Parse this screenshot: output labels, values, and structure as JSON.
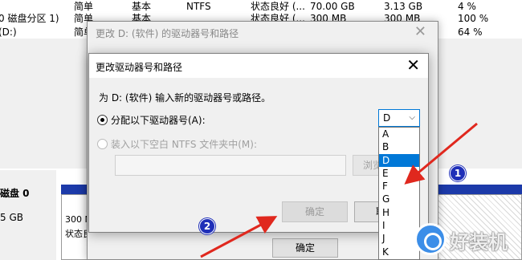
{
  "background": {
    "rows": [
      {
        "name": "",
        "layout": "简单",
        "type": "基本",
        "fs": "NTFS",
        "status": "状态良好 (...",
        "capacity": "70.00 GB",
        "free": "3.13 GB",
        "pct": "4 %"
      },
      {
        "name": "0 磁盘分区 1)",
        "layout": "简单",
        "type": "基本",
        "fs": "",
        "status": "状态良好 (...",
        "capacity": "300 MB",
        "free": "300 MB",
        "pct": "100 %"
      },
      {
        "name": "(D:)",
        "layout": "简单",
        "type": "",
        "fs": "",
        "status": "",
        "capacity": "",
        "free": "",
        "pct": "64 %"
      }
    ],
    "disk_label": "磁盘 0",
    "disk_size": "5 GB",
    "partition_size": "300 M",
    "partition_status": "状态良"
  },
  "outer_dialog": {
    "title": "更改 D: (软件) 的驱动器号和路径",
    "ok_label": "确定"
  },
  "inner_dialog": {
    "title": "更改驱动器号和路径",
    "instruction": "为 D: (软件) 输入新的驱动器号或路径。",
    "option_assign": "分配以下驱动器号(A):",
    "option_mount": "装入以下空白 NTFS 文件夹中(M):",
    "browse_label": "浏览",
    "ok_label": "确定",
    "cancel_label": "取消"
  },
  "drive_select": {
    "value": "D",
    "options": [
      "A",
      "B",
      "D",
      "E",
      "F",
      "G",
      "H",
      "I",
      "J",
      "K"
    ],
    "selected": "D"
  },
  "annotations": {
    "badge1": "1",
    "badge2": "2"
  },
  "watermark": {
    "text": "好装机"
  },
  "colors": {
    "accent": "#0078d7",
    "badge": "#1f2fb8",
    "arrow": "#e0281e"
  }
}
